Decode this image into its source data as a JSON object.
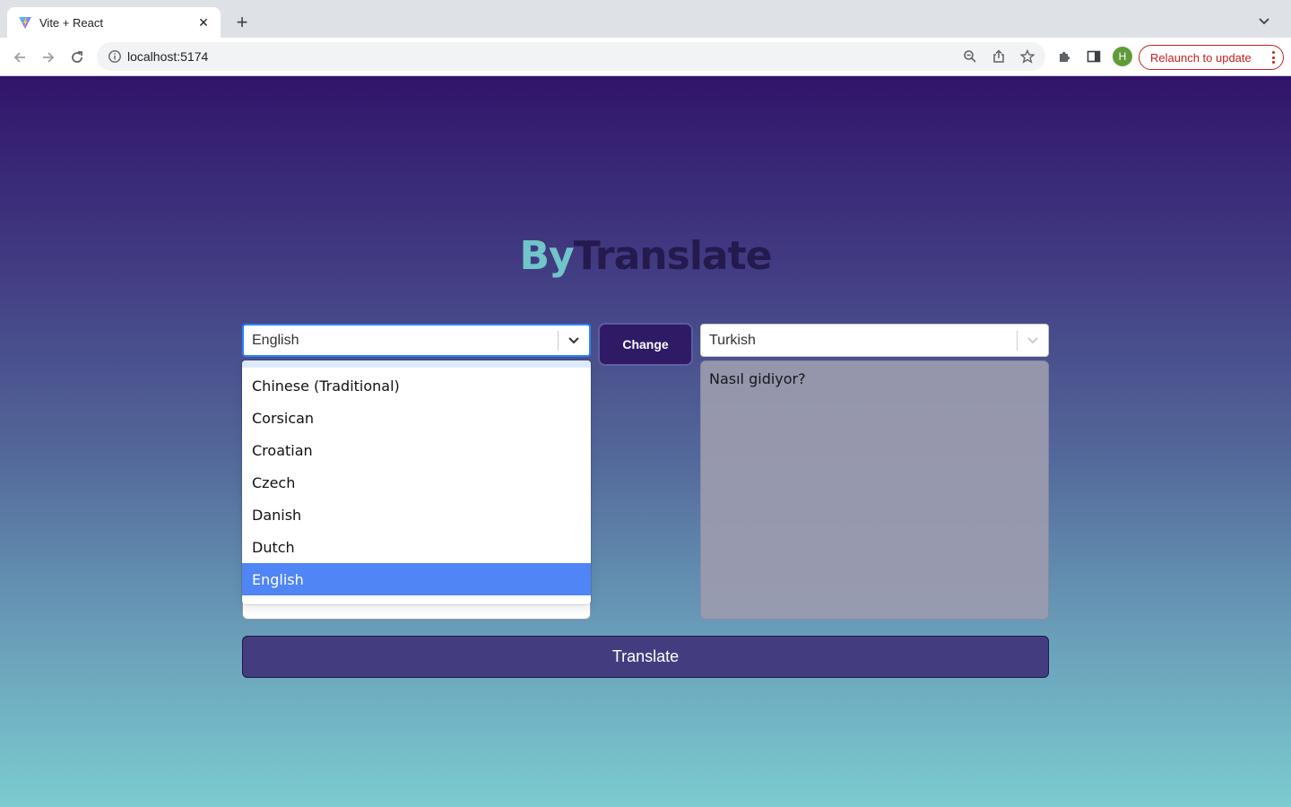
{
  "browser": {
    "tab_title": "Vite + React",
    "tab_close_glyph": "✕",
    "new_tab_glyph": "+",
    "url": "localhost:5174",
    "profile_initial": "H",
    "relaunch_label": "Relaunch to update",
    "accent_color": "#c5221f"
  },
  "app": {
    "brand_prefix": "By",
    "brand_suffix": "Translate",
    "source_language": "English",
    "target_language": "Turkish",
    "change_label": "Change",
    "translated_text": "Nasıl gidiyor?",
    "translate_label": "Translate",
    "dropdown_options": [
      "Chinese (Traditional)",
      "Corsican",
      "Croatian",
      "Czech",
      "Danish",
      "Dutch",
      "English"
    ],
    "dropdown_selected": "English",
    "colors": {
      "brand_prefix": "#6fc5c9",
      "brand_suffix": "#241a4e",
      "selected_option": "#4f85f5",
      "button": "#433d80"
    }
  }
}
